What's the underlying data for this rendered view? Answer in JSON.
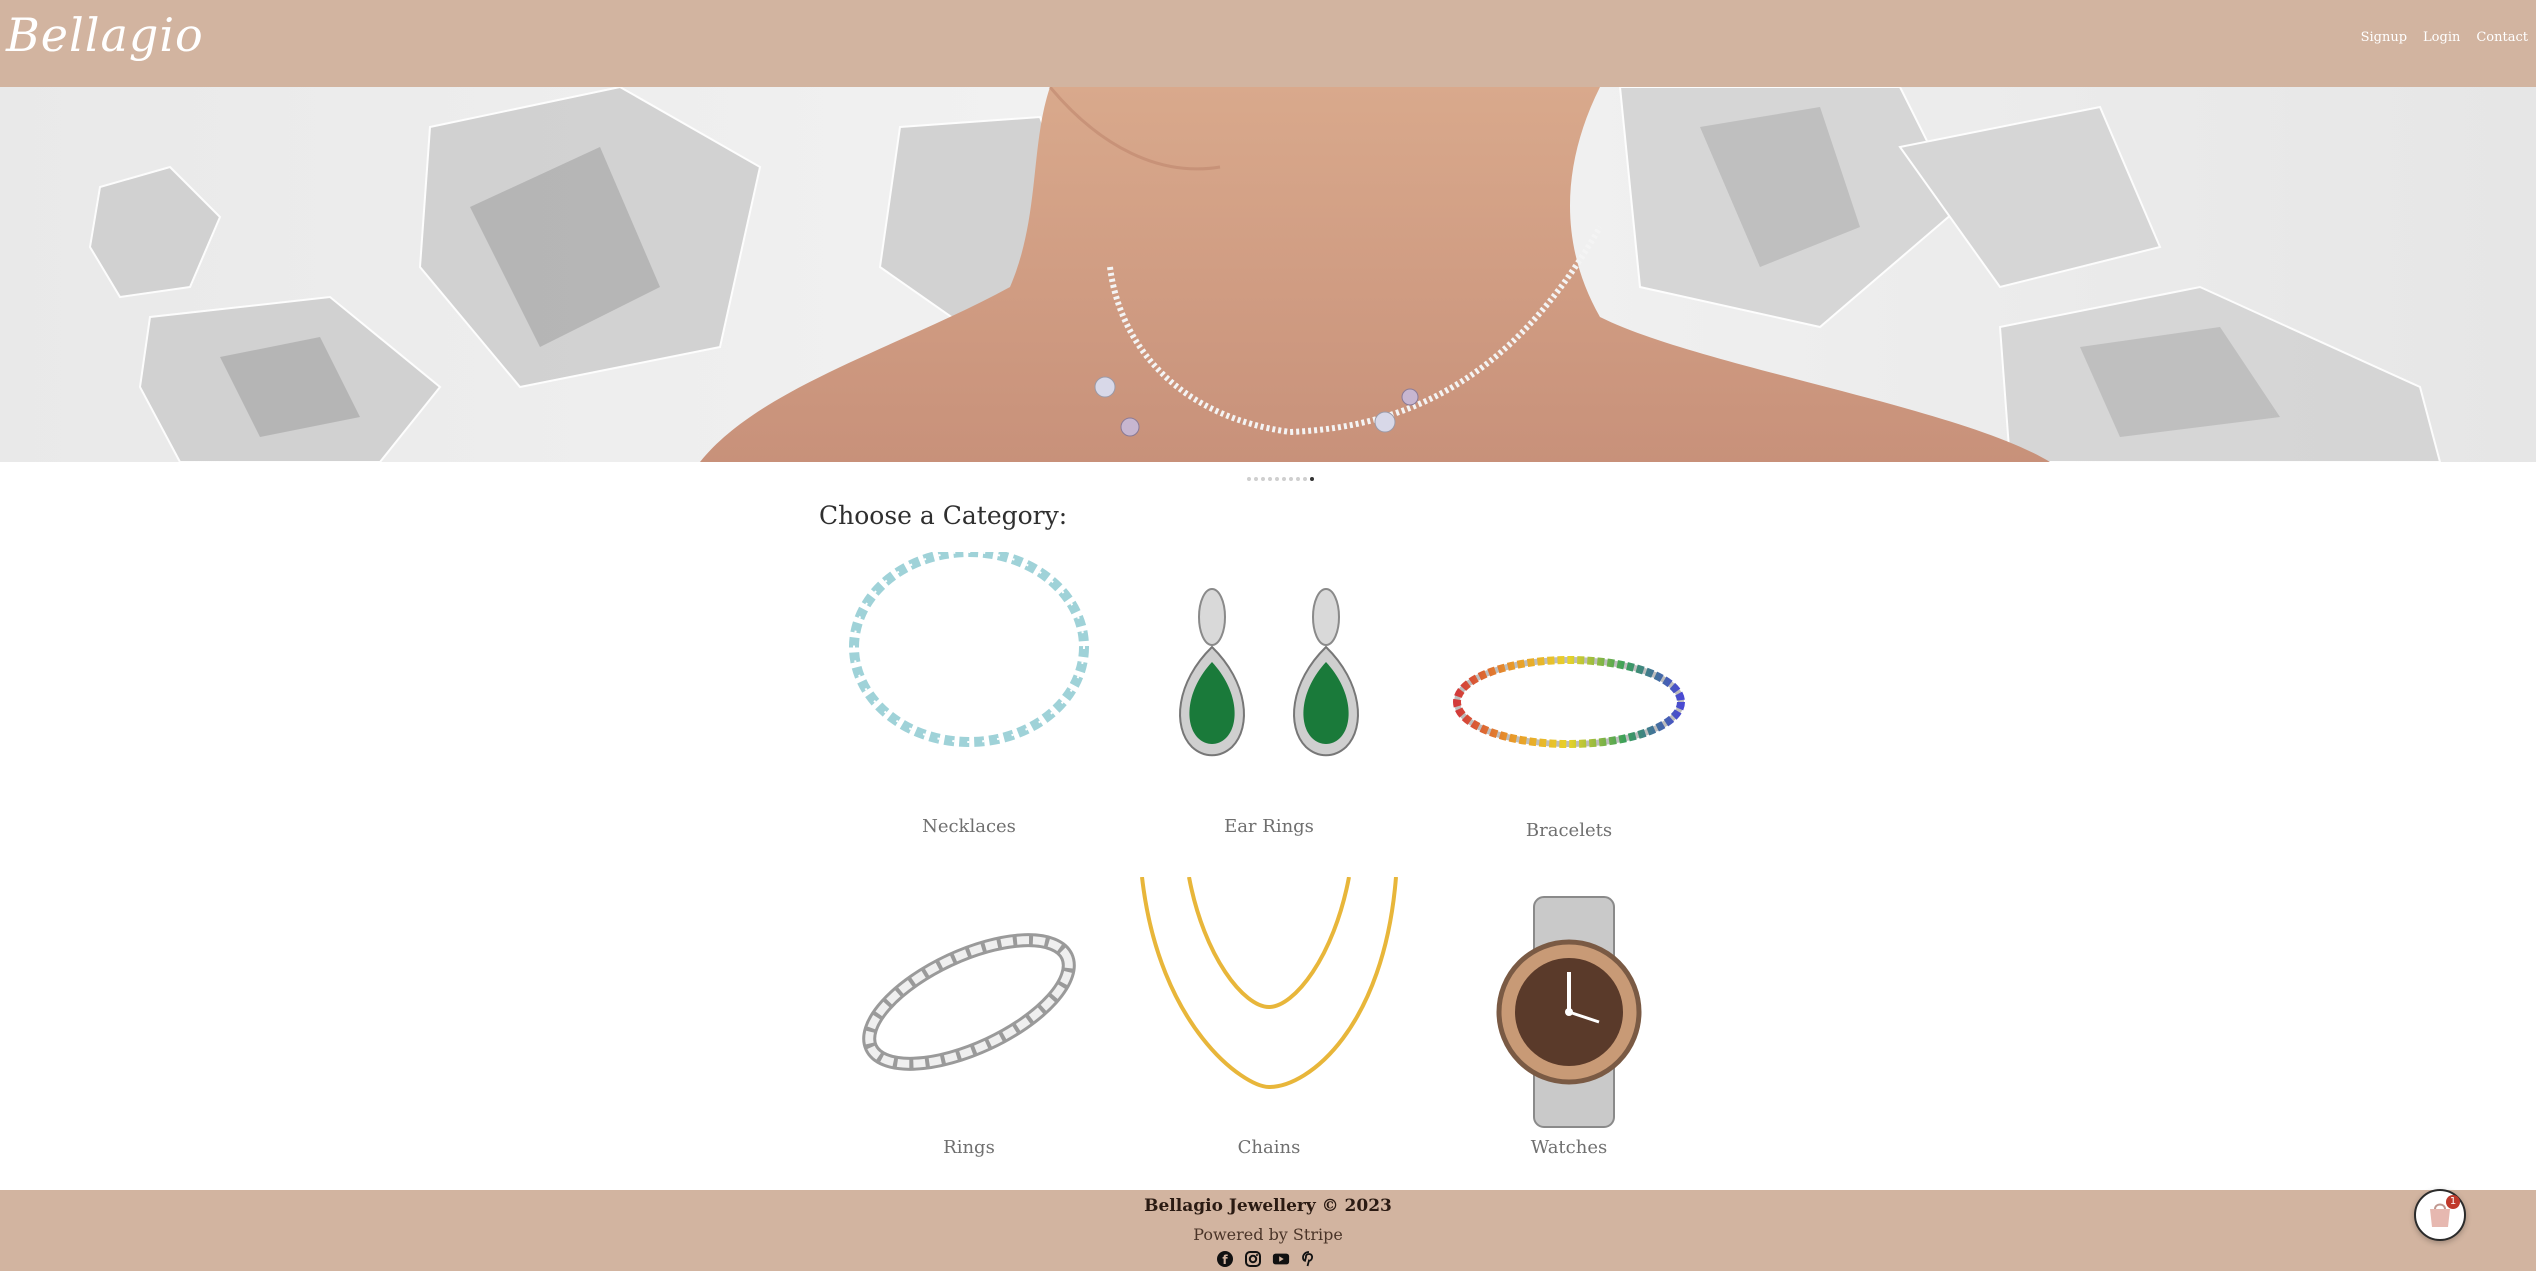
{
  "header": {
    "logo": "Bellagio",
    "nav": [
      "Signup",
      "Login",
      "Contact"
    ]
  },
  "hero": {
    "slide_count": 10,
    "active_slide": 10
  },
  "categories": {
    "title": "Choose a Category:",
    "items": [
      "Necklaces",
      "Ear Rings",
      "Bracelets",
      "Rings",
      "Chains",
      "Watches"
    ]
  },
  "footer": {
    "copyright": "Bellagio Jewellery © 2023",
    "powered": "Powered by Stripe",
    "socials": [
      "facebook-icon",
      "instagram-icon",
      "youtube-icon",
      "pinterest-icon"
    ]
  },
  "cart": {
    "count": "1"
  },
  "colors": {
    "brand": "#d2b4a0"
  }
}
